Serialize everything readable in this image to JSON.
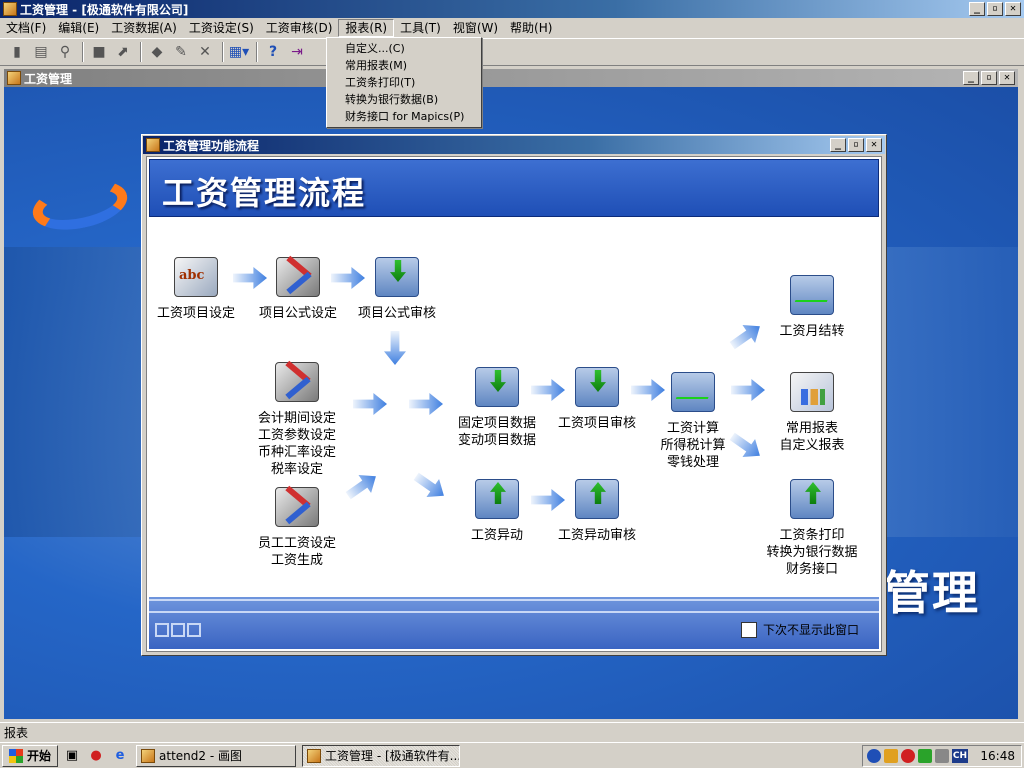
{
  "app": {
    "title": "工资管理 - [极通软件有限公司]",
    "controls": [
      "_",
      "▫",
      "✕"
    ]
  },
  "menubar": [
    {
      "label": "文档(F)"
    },
    {
      "label": "编辑(E)"
    },
    {
      "label": "工资数据(A)"
    },
    {
      "label": "工资设定(S)"
    },
    {
      "label": "工资审核(D)"
    },
    {
      "label": "报表(R)"
    },
    {
      "label": "工具(T)"
    },
    {
      "label": "视窗(W)"
    },
    {
      "label": "帮助(H)"
    }
  ],
  "report_menu": [
    {
      "label": "自定义...(C)"
    },
    {
      "label": "常用报表(M)"
    },
    {
      "label": "工资条打印(T)"
    },
    {
      "label": "转换为银行数据(B)"
    },
    {
      "label": "财务接口 for Mapics(P)"
    }
  ],
  "toolbar": {
    "icons": [
      "new-icon",
      "print-icon",
      "search-icon",
      "stop-icon",
      "export-icon",
      "approve-icon",
      "edit-icon",
      "delete-icon",
      "window-icon",
      "help-icon",
      "exit-icon"
    ],
    "help_glyph": "?"
  },
  "child_window": {
    "title": "工资管理",
    "bg_text": "管理"
  },
  "dialog": {
    "title": "工资管理功能流程",
    "header": "工资管理流程",
    "checkbox_label": "下次不显示此窗口",
    "checkbox_checked": false
  },
  "flow": {
    "n1": {
      "lines": [
        "工资项目设定"
      ],
      "icon": "abc-icon",
      "icon_text": "abc"
    },
    "n2": {
      "lines": [
        "项目公式设定"
      ],
      "icon": "tools-icon"
    },
    "n3": {
      "lines": [
        "项目公式审核"
      ],
      "icon": "folder-down-icon"
    },
    "n4": {
      "lines": [
        "会计期间设定",
        "工资参数设定",
        "币种汇率设定",
        "税率设定"
      ],
      "icon": "tools-icon"
    },
    "n5": {
      "lines": [
        "员工工资设定",
        "工资生成"
      ],
      "icon": "tools-icon"
    },
    "n6": {
      "lines": [
        "固定项目数据",
        "变动项目数据"
      ],
      "icon": "folder-down-icon"
    },
    "n7": {
      "lines": [
        "工资项目审核"
      ],
      "icon": "folder-down-icon"
    },
    "n8": {
      "lines": [
        "工资计算",
        "所得税计算",
        "零钱处理"
      ],
      "icon": "wave-icon"
    },
    "n9": {
      "lines": [
        "工资月结转"
      ],
      "icon": "wave-icon"
    },
    "n10": {
      "lines": [
        "常用报表",
        "自定义报表"
      ],
      "icon": "report-icon"
    },
    "n11": {
      "lines": [
        "工资异动"
      ],
      "icon": "folder-up-icon"
    },
    "n12": {
      "lines": [
        "工资异动审核"
      ],
      "icon": "folder-up-icon"
    },
    "n13": {
      "lines": [
        "工资条打印",
        "转换为银行数据",
        "财务接口"
      ],
      "icon": "folder-up-icon"
    }
  },
  "statusbar": {
    "text": "报表"
  },
  "taskbar": {
    "start": "开始",
    "tasks": [
      "attend2 - 画图",
      "工资管理 - [极通软件有..."
    ],
    "tray_lang": "CH",
    "clock": "16:48"
  },
  "colors": {
    "titlebar": "#0a246a",
    "workspace": "#1d5ab8",
    "dialog_header": "#1f4fb6",
    "flow_arrow": "#3f7fe0",
    "accent_green": "#1bd11b"
  }
}
